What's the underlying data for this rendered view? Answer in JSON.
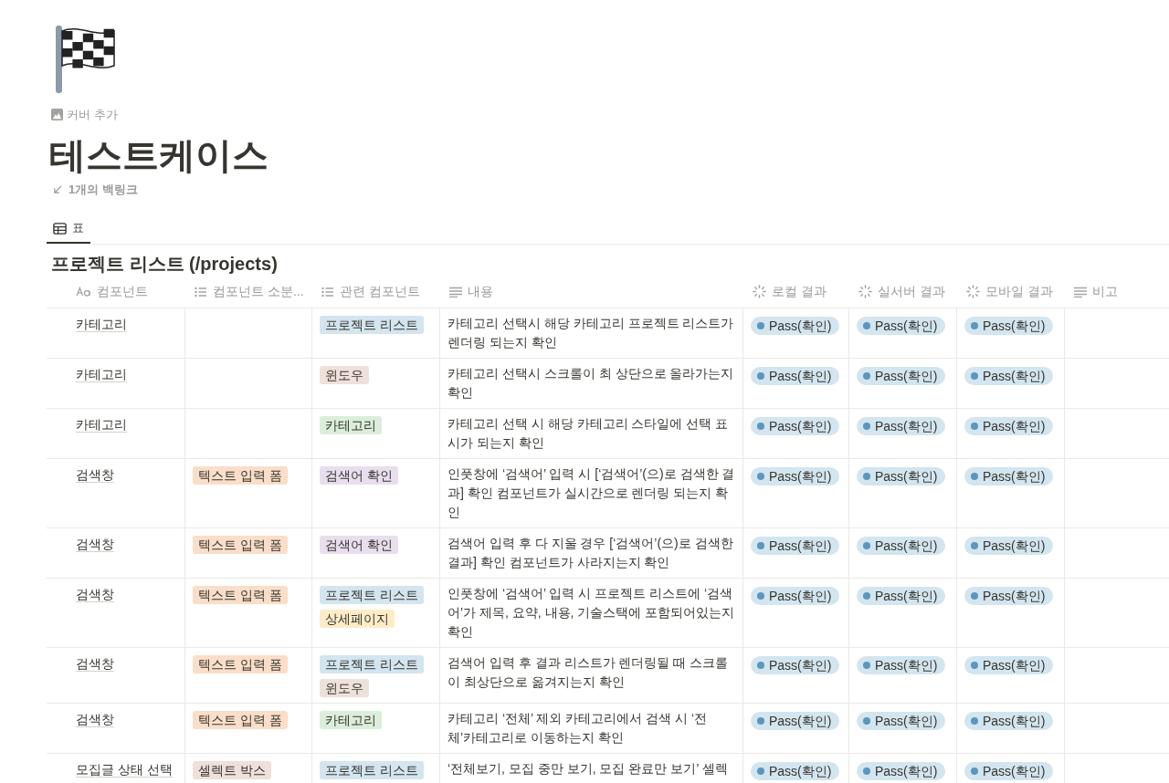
{
  "page": {
    "cover_action": "커버 추가",
    "title": "테스트케이스",
    "backlinks": "1개의 백링크"
  },
  "views": [
    {
      "label": "표",
      "selected": true
    }
  ],
  "table": {
    "title": "프로젝트 리스트 (/projects)",
    "columns": [
      {
        "label": "컴포넌트",
        "kind": "title"
      },
      {
        "label": "컴포넌트 소분...",
        "kind": "multi_select"
      },
      {
        "label": "관련 컴포넌트",
        "kind": "multi_select"
      },
      {
        "label": "내용",
        "kind": "text"
      },
      {
        "label": "로컬 결과",
        "kind": "status"
      },
      {
        "label": "실서버 결과",
        "kind": "status"
      },
      {
        "label": "모바일 결과",
        "kind": "status"
      },
      {
        "label": "비고",
        "kind": "text"
      }
    ],
    "rows": [
      {
        "component": "카테고리",
        "subcategory": [],
        "related": [
          {
            "label": "프로젝트 리스트",
            "color": "#d3e5ef"
          }
        ],
        "content": "카테고리 선택시 해당 카테고리 프로젝트 리스트가 렌더링 되는지 확인",
        "results": [
          {
            "label": "Pass(확인)",
            "color": "#5b97bd"
          },
          {
            "label": "Pass(확인)",
            "color": "#5b97bd"
          },
          {
            "label": "Pass(확인)",
            "color": "#5b97bd"
          }
        ]
      },
      {
        "component": "카테고리",
        "subcategory": [],
        "related": [
          {
            "label": "윈도우",
            "color": "#eee0da"
          }
        ],
        "content": "카테고리 선택시 스크롤이 최 상단으로 올라가는지 확인",
        "results": [
          {
            "label": "Pass(확인)",
            "color": "#5b97bd"
          },
          {
            "label": "Pass(확인)",
            "color": "#5b97bd"
          },
          {
            "label": "Pass(확인)",
            "color": "#5b97bd"
          }
        ]
      },
      {
        "component": "카테고리",
        "subcategory": [],
        "related": [
          {
            "label": "카테고리",
            "color": "#dbeddb"
          }
        ],
        "content": "카테고리 선택 시 해당 카테고리 스타일에 선택 표시가 되는지 확인",
        "results": [
          {
            "label": "Pass(확인)",
            "color": "#5b97bd"
          },
          {
            "label": "Pass(확인)",
            "color": "#5b97bd"
          },
          {
            "label": "Pass(확인)",
            "color": "#5b97bd"
          }
        ]
      },
      {
        "component": "검색창",
        "subcategory": [
          {
            "label": "텍스트 입력 폼",
            "color": "#fadec9"
          }
        ],
        "related": [
          {
            "label": "검색어 확인",
            "color": "#e8deee"
          }
        ],
        "content": "인풋창에 ‘검색어’ 입력 시 [‘검색어’(으)로 검색한 결과] 확인 컴포넌트가 실시간으로 렌더링 되는지 확인",
        "results": [
          {
            "label": "Pass(확인)",
            "color": "#5b97bd"
          },
          {
            "label": "Pass(확인)",
            "color": "#5b97bd"
          },
          {
            "label": "Pass(확인)",
            "color": "#5b97bd"
          }
        ]
      },
      {
        "component": "검색창",
        "subcategory": [
          {
            "label": "텍스트 입력 폼",
            "color": "#fadec9"
          }
        ],
        "related": [
          {
            "label": "검색어 확인",
            "color": "#e8deee"
          }
        ],
        "content": "검색어 입력 후 다 지울 경우 [‘검색어’(으)로 검색한 결과] 확인 컴포넌트가 사라지는지 확인",
        "results": [
          {
            "label": "Pass(확인)",
            "color": "#5b97bd"
          },
          {
            "label": "Pass(확인)",
            "color": "#5b97bd"
          },
          {
            "label": "Pass(확인)",
            "color": "#5b97bd"
          }
        ]
      },
      {
        "component": "검색창",
        "subcategory": [
          {
            "label": "텍스트 입력 폼",
            "color": "#fadec9"
          }
        ],
        "related": [
          {
            "label": "프로젝트 리스트",
            "color": "#d3e5ef"
          },
          {
            "label": "상세페이지",
            "color": "#fdecc8"
          }
        ],
        "content": "인풋창에 ‘검색어’ 입력 시 프로젝트 리스트에 ‘검색어’가 제목, 요약, 내용, 기술스택에 포함되어있는지 확인",
        "results": [
          {
            "label": "Pass(확인)",
            "color": "#5b97bd"
          },
          {
            "label": "Pass(확인)",
            "color": "#5b97bd"
          },
          {
            "label": "Pass(확인)",
            "color": "#5b97bd"
          }
        ]
      },
      {
        "component": "검색창",
        "subcategory": [
          {
            "label": "텍스트 입력 폼",
            "color": "#fadec9"
          }
        ],
        "related": [
          {
            "label": "프로젝트 리스트",
            "color": "#d3e5ef"
          },
          {
            "label": "윈도우",
            "color": "#eee0da"
          }
        ],
        "content": "검색어 입력 후 결과 리스트가 렌더링될 때 스크롤이 최상단으로 옮겨지는지 확인",
        "results": [
          {
            "label": "Pass(확인)",
            "color": "#5b97bd"
          },
          {
            "label": "Pass(확인)",
            "color": "#5b97bd"
          },
          {
            "label": "Pass(확인)",
            "color": "#5b97bd"
          }
        ]
      },
      {
        "component": "검색창",
        "subcategory": [
          {
            "label": "텍스트 입력 폼",
            "color": "#fadec9"
          }
        ],
        "related": [
          {
            "label": "카테고리",
            "color": "#dbeddb"
          }
        ],
        "content": "카테고리 ‘전체’ 제외 카테고리에서 검색 시 ‘전체’카테고리로 이동하는지 확인",
        "results": [
          {
            "label": "Pass(확인)",
            "color": "#5b97bd"
          },
          {
            "label": "Pass(확인)",
            "color": "#5b97bd"
          },
          {
            "label": "Pass(확인)",
            "color": "#5b97bd"
          }
        ]
      },
      {
        "component": "모집글 상태 선택",
        "subcategory": [
          {
            "label": "셀렉트 박스",
            "color": "#eee0da"
          }
        ],
        "related": [
          {
            "label": "프로젝트 리스트",
            "color": "#d3e5ef"
          }
        ],
        "content": "‘전체보기, 모집 중만 보기, 모집 완료만 보기’ 셀렉",
        "results": [
          {
            "label": "Pass(확인)",
            "color": "#5b97bd"
          },
          {
            "label": "Pass(확인)",
            "color": "#5b97bd"
          },
          {
            "label": "Pass(확인)",
            "color": "#5b97bd"
          }
        ]
      }
    ]
  }
}
